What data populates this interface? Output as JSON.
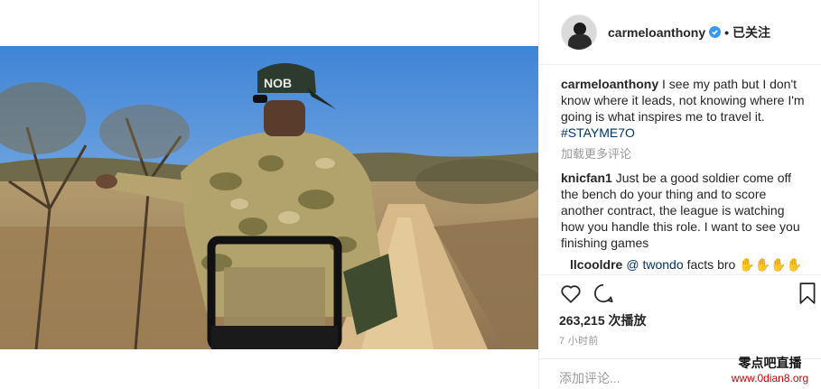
{
  "post": {
    "username": "carmeloanthony",
    "follow_state": "已关注",
    "separator": "•"
  },
  "caption": {
    "username": "carmeloanthony",
    "text": "I see my path but I don't know where it leads, not knowing where I'm going is what inspires me to travel it.",
    "hashtag": "#STAYME7O"
  },
  "load_more": "加载更多评论",
  "comments": [
    {
      "username": "knicfan1",
      "text": "Just be a good soldier come off the bench do your thing and to score another contract, the league is watching how you handle this role. I want to see you finishing games"
    }
  ],
  "reply": {
    "username": "llcooldre",
    "mention": "@ twondo",
    "text": "facts bro",
    "emoji": "✋✋✋✋"
  },
  "stats": {
    "views": "263,215 次播放",
    "time": "7 小时前"
  },
  "add_comment_placeholder": "添加评论...",
  "watermark": {
    "line1": "零点吧直播",
    "line2": "www.0dian8.org"
  },
  "video": {
    "cap_text": "NOB"
  },
  "colors": {
    "link": "#003569",
    "verified": "#3897f0",
    "muted": "#999999"
  }
}
